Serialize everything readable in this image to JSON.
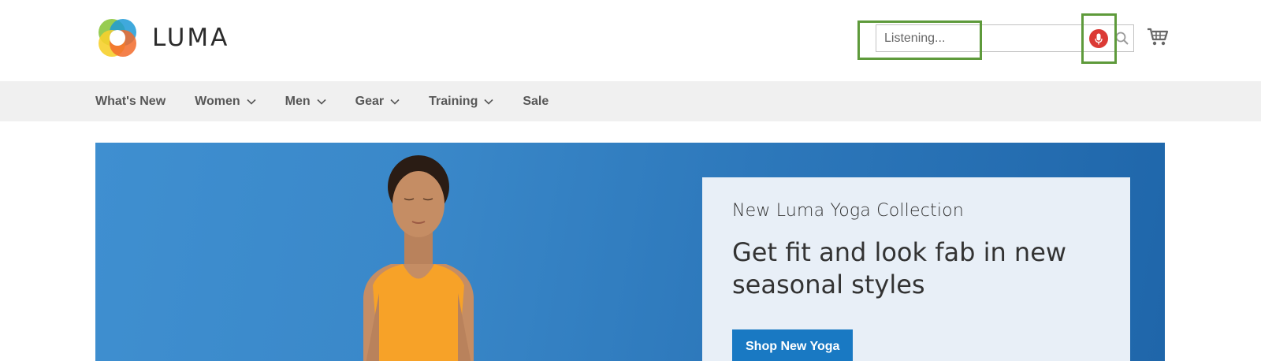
{
  "header": {
    "logo_text": "LUMA",
    "search": {
      "placeholder": "Listening...",
      "value": ""
    },
    "icons": {
      "mic": "microphone-icon",
      "search": "search-icon",
      "cart": "cart-icon"
    }
  },
  "nav": {
    "items": [
      {
        "label": "What's New",
        "has_dropdown": false
      },
      {
        "label": "Women",
        "has_dropdown": true
      },
      {
        "label": "Men",
        "has_dropdown": true
      },
      {
        "label": "Gear",
        "has_dropdown": true
      },
      {
        "label": "Training",
        "has_dropdown": true
      },
      {
        "label": "Sale",
        "has_dropdown": false
      }
    ]
  },
  "hero": {
    "kicker": "New Luma Yoga Collection",
    "headline": "Get fit and look fab in new seasonal styles",
    "cta_label": "Shop New Yoga"
  },
  "colors": {
    "accent_blue": "#1979c3",
    "mic_red": "#db3a35",
    "highlight_green": "#5e9a3b",
    "nav_bg": "#f0f0f0"
  }
}
